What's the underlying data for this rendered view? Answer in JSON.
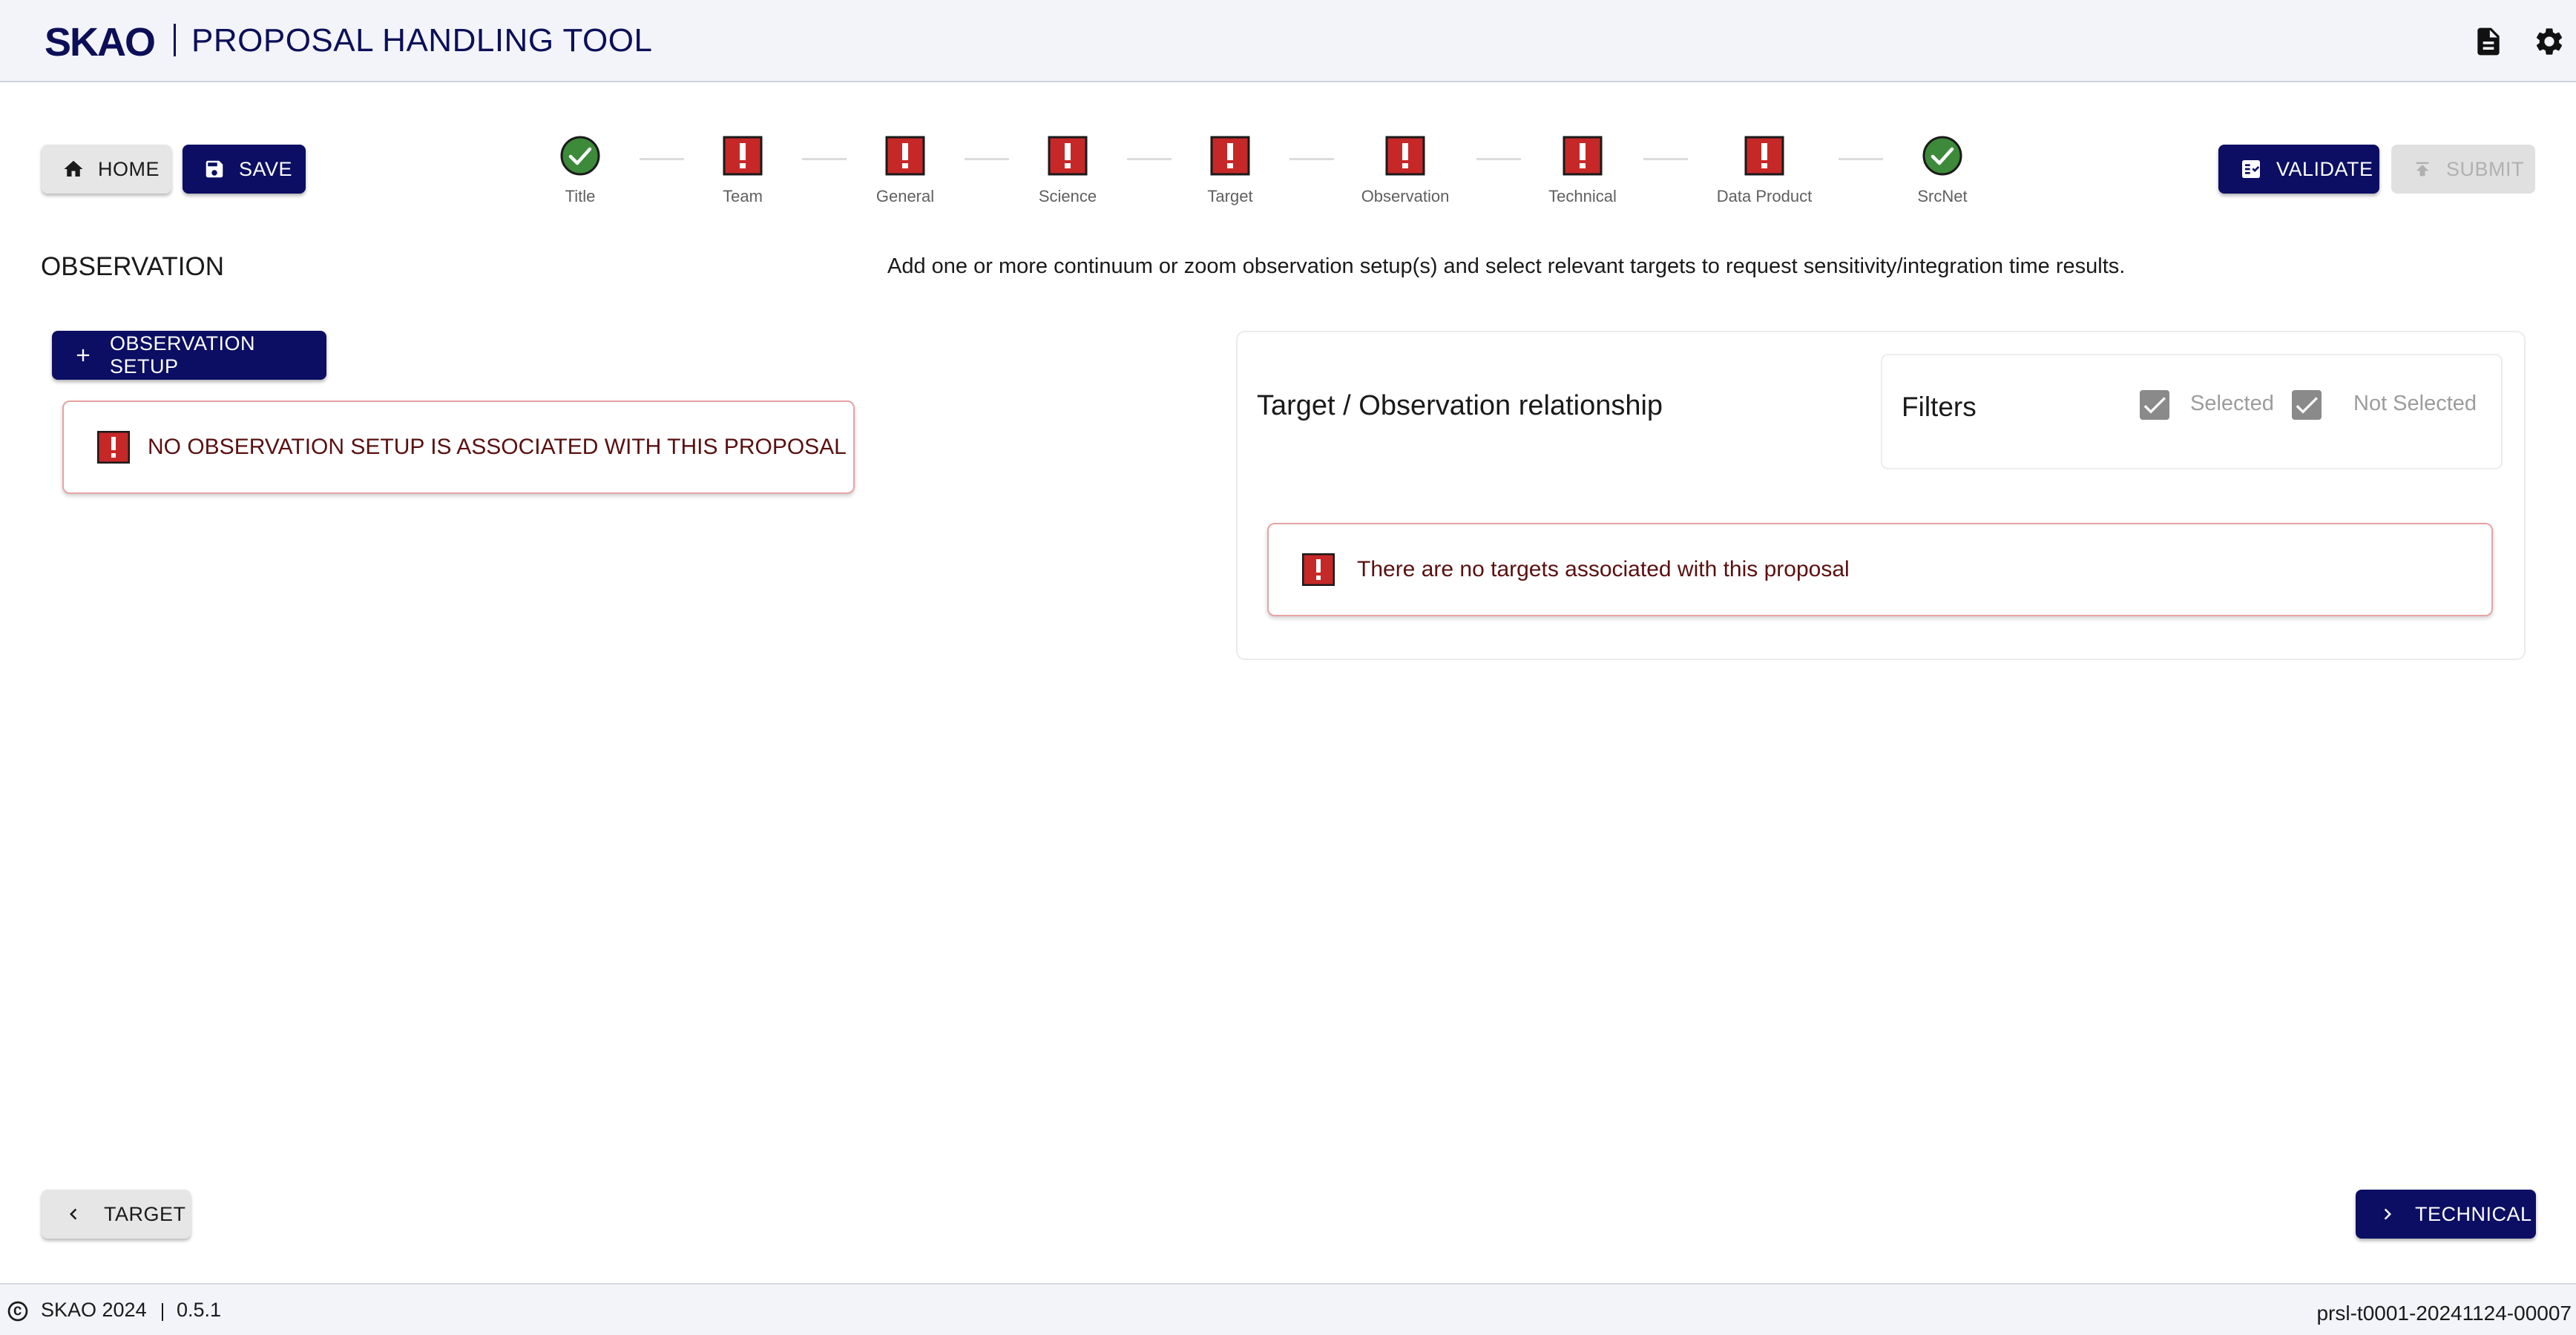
{
  "header": {
    "logo_text": "SKAO",
    "title": "PROPOSAL HANDLING TOOL"
  },
  "toolbar": {
    "home_label": "HOME",
    "save_label": "SAVE",
    "validate_label": "VALIDATE",
    "submit_label": "SUBMIT"
  },
  "stepper": [
    {
      "label": "Title",
      "status": "complete"
    },
    {
      "label": "Team",
      "status": "error"
    },
    {
      "label": "General",
      "status": "error"
    },
    {
      "label": "Science",
      "status": "error"
    },
    {
      "label": "Target",
      "status": "error"
    },
    {
      "label": "Observation",
      "status": "error"
    },
    {
      "label": "Technical",
      "status": "error"
    },
    {
      "label": "Data Product",
      "status": "error"
    },
    {
      "label": "SrcNet",
      "status": "complete"
    }
  ],
  "page": {
    "title": "OBSERVATION",
    "description": "Add one or more continuum or zoom observation setup(s) and select relevant targets to request sensitivity/integration time results."
  },
  "observation": {
    "add_button_label": "OBSERVATION SETUP",
    "empty_alert": "NO OBSERVATION SETUP IS ASSOCIATED WITH THIS PROPOSAL"
  },
  "relationship": {
    "title": "Target / Observation relationship",
    "filters_label": "Filters",
    "filter_selected_label": "Selected",
    "filter_selected_checked": true,
    "filter_not_selected_label": "Not Selected",
    "filter_not_selected_checked": true,
    "empty_alert": "There are no targets associated with this proposal"
  },
  "navigation": {
    "back_label": "TARGET",
    "next_label": "TECHNICAL"
  },
  "footer": {
    "copyright": "SKAO 2024",
    "version": "0.5.1",
    "proposal_id": "prsl-t0001-20241124-00007"
  },
  "colors": {
    "brand_navy": "#0b0e63",
    "error_red": "#c62828",
    "success_green": "#3c8a3a"
  },
  "icons": {
    "home": "home-icon",
    "save": "save-icon",
    "validate": "validate-icon",
    "submit": "submit-icon",
    "document": "document-icon",
    "settings": "gear-icon",
    "add": "plus-icon",
    "error": "error-icon",
    "complete": "check-circle-icon",
    "back": "chevron-left-icon",
    "next": "chevron-right-icon",
    "copyright": "copyright-icon"
  }
}
